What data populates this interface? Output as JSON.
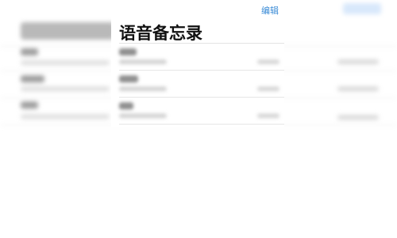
{
  "header": {
    "title": "语音备忘录",
    "edit_label": "编辑"
  },
  "memos": [
    {
      "state": "blurred"
    },
    {
      "state": "blurred"
    },
    {
      "state": "blurred"
    }
  ],
  "colors": {
    "accent": "#3a8bd6",
    "title_text": "#111111",
    "background": "#ffffff"
  }
}
